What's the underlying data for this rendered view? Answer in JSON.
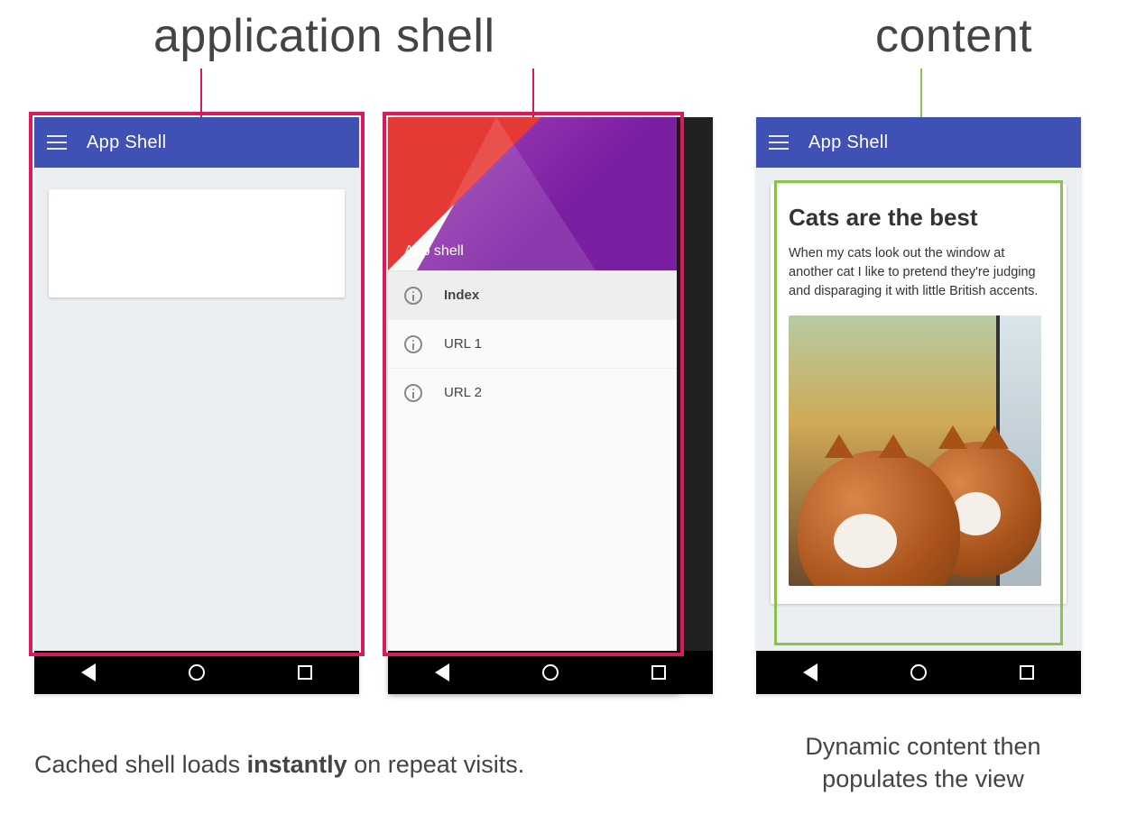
{
  "labels": {
    "shell": "application shell",
    "content": "content"
  },
  "appbar_title": "App Shell",
  "drawer": {
    "hero_label": "App shell",
    "items": [
      {
        "label": "Index",
        "active": true
      },
      {
        "label": "URL 1",
        "active": false
      },
      {
        "label": "URL 2",
        "active": false
      }
    ]
  },
  "article": {
    "title": "Cats are the best",
    "body": "When my cats look out the window at another cat I like to pretend they're judging and disparaging it with little British accents."
  },
  "captions": {
    "left_pre": "Cached shell loads ",
    "left_strong": "instantly",
    "left_post": " on repeat visits.",
    "right": "Dynamic content then populates the view"
  },
  "colors": {
    "outline_pink": "#d81b60",
    "outline_green": "#8bc34a",
    "appbar": "#3f51b5"
  }
}
